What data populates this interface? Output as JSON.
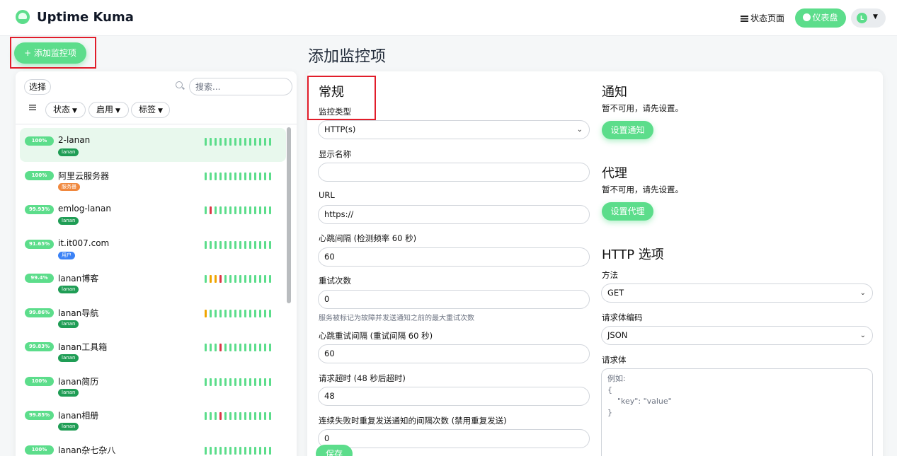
{
  "app": {
    "brand": "Uptime Kuma",
    "nav": {
      "status_pages": "状态页面",
      "dashboard": "仪表盘",
      "avatar_letter": "L"
    }
  },
  "sidebar": {
    "add_button": "+ 添加监控项",
    "select_label": "选择",
    "search_placeholder": "搜索...",
    "filters": [
      "状态",
      "启用",
      "标签"
    ],
    "monitors": [
      {
        "uptime": "100%",
        "name": "2-lanan",
        "tag": "lanan",
        "tag_color": "#1f9d55",
        "beats": "gggggggggggggg"
      },
      {
        "uptime": "100%",
        "name": "阿里云服务器",
        "tag": "服务器",
        "tag_color": "#f0883e",
        "beats": "gggggggggggggg"
      },
      {
        "uptime": "99.93%",
        "name": "emlog-lanan",
        "tag": "lanan",
        "tag_color": "#1f9d55",
        "beats": "grgggggggggggg"
      },
      {
        "uptime": "91.65%",
        "name": "it.it007.com",
        "tag": "用户",
        "tag_color": "#3b82f6",
        "beats": "gggggggggggggg"
      },
      {
        "uptime": "99.4%",
        "name": "lanan博客",
        "tag": "lanan",
        "tag_color": "#1f9d55",
        "beats": "goorgggggggggg"
      },
      {
        "uptime": "99.86%",
        "name": "lanan导航",
        "tag": "lanan",
        "tag_color": "#1f9d55",
        "beats": "oggggggggggggg"
      },
      {
        "uptime": "99.83%",
        "name": "lanan工具箱",
        "tag": "lanan",
        "tag_color": "#1f9d55",
        "beats": "gggrgggggggggg"
      },
      {
        "uptime": "100%",
        "name": "lanan简历",
        "tag": "lanan",
        "tag_color": "#1f9d55",
        "beats": "gggggggggggggg"
      },
      {
        "uptime": "99.85%",
        "name": "lanan相册",
        "tag": "lanan",
        "tag_color": "#1f9d55",
        "beats": "gggrgggggggggg"
      },
      {
        "uptime": "100%",
        "name": "lanan杂七杂八",
        "tag": "lanan",
        "tag_color": "#1f9d55",
        "beats": "gggggggggggggg"
      }
    ]
  },
  "page_title": "添加监控项",
  "form": {
    "general_heading": "常规",
    "monitor_type_label": "监控类型",
    "monitor_type_value": "HTTP(s)",
    "display_name_label": "显示名称",
    "display_name_value": "",
    "url_label": "URL",
    "url_value": "https://",
    "heartbeat_label": "心跳间隔 (检测频率 60 秒)",
    "heartbeat_value": "60",
    "retries_label": "重试次数",
    "retries_value": "0",
    "retries_help": "服务被标记为故障并发送通知之前的最大重试次数",
    "retry_interval_label": "心跳重试间隔 (重试间隔 60 秒)",
    "retry_interval_value": "60",
    "timeout_label": "请求超时 (48 秒后超时)",
    "timeout_value": "48",
    "resend_label": "连续失败时重复发送通知的间隔次数 (禁用重复发送)",
    "resend_value": "0",
    "save_button": "保存"
  },
  "notify": {
    "heading": "通知",
    "unavailable": "暂不可用，请先设置。",
    "setup_button": "设置通知"
  },
  "proxy": {
    "heading": "代理",
    "unavailable": "暂不可用，请先设置。",
    "setup_button": "设置代理"
  },
  "http": {
    "heading": "HTTP 选项",
    "method_label": "方法",
    "method_value": "GET",
    "encoding_label": "请求体编码",
    "encoding_value": "JSON",
    "body_label": "请求体",
    "body_placeholder": "例如:\n{\n    \"key\": \"value\"\n}"
  }
}
